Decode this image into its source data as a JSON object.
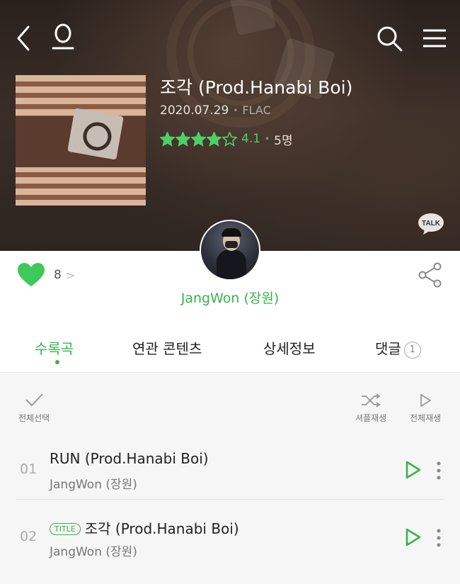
{
  "header": {
    "back_icon": "chevron-left-icon",
    "profile_icon": "person-icon",
    "search_icon": "search-icon",
    "menu_icon": "hamburger-menu-icon"
  },
  "album": {
    "title": "조각 (Prod.Hanabi Boi)",
    "release_date": "2020.07.29",
    "format": "FLAC",
    "rating": "4.1",
    "rating_fraction": 0.82,
    "rating_count": "5명",
    "talk_label": "TALK"
  },
  "artist": {
    "name": "JangWon (장원)"
  },
  "likes": {
    "count": "8",
    "chevron": ">"
  },
  "tabs": [
    {
      "label": "수록곡",
      "active": true
    },
    {
      "label": "연관 콘텐츠",
      "active": false
    },
    {
      "label": "상세정보",
      "active": false
    },
    {
      "label": "댓글",
      "badge": "1",
      "active": false
    }
  ],
  "toolbar": {
    "select_all": "전체선택",
    "shuffle": "셔플재생",
    "play_all": "전체재생"
  },
  "tracks": [
    {
      "num": "01",
      "title": "RUN (Prod.Hanabi Boi)",
      "artist": "JangWon (장원)",
      "badge": ""
    },
    {
      "num": "02",
      "title": "조각 (Prod.Hanabi Boi)",
      "artist": "JangWon (장원)",
      "badge": "TITLE"
    }
  ],
  "colors": {
    "accent": "#38b34f",
    "rating_green": "#4cd068",
    "heart_green": "#3ec95a"
  }
}
